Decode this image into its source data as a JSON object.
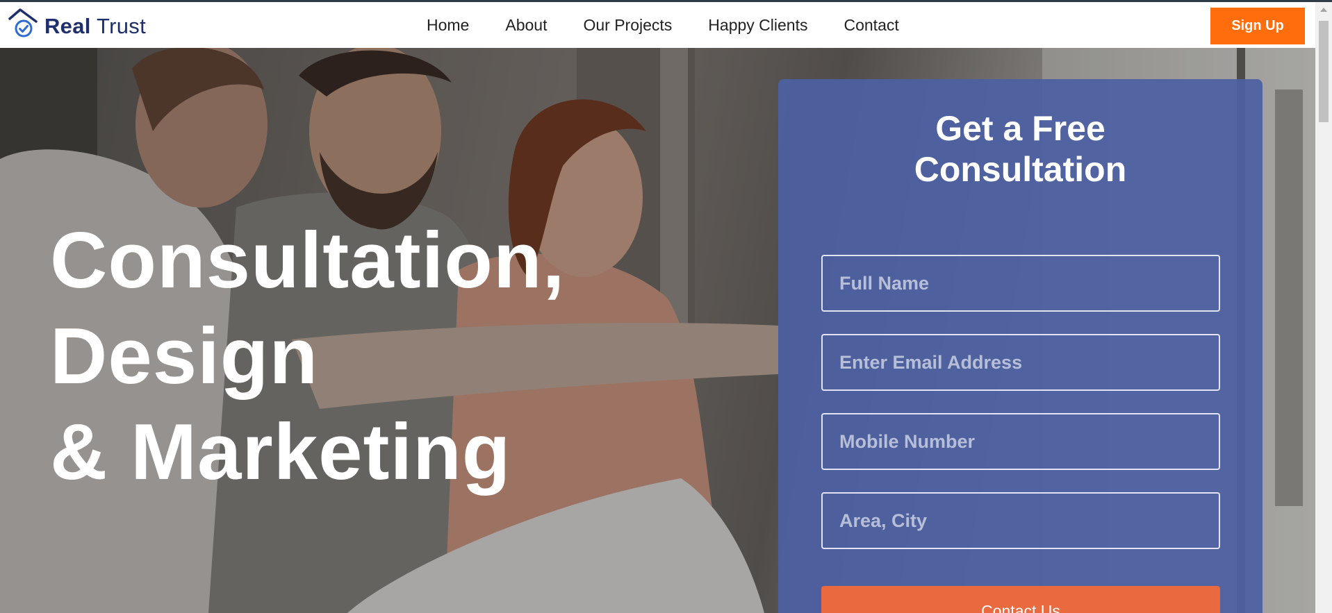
{
  "brand": {
    "name_bold": "Real",
    "name_rest": "Trust",
    "logo_icon": "house-check-icon",
    "color": "#1e2f6b"
  },
  "nav": {
    "items": [
      {
        "label": "Home"
      },
      {
        "label": "About"
      },
      {
        "label": "Our Projects"
      },
      {
        "label": "Happy Clients"
      },
      {
        "label": "Contact"
      }
    ],
    "signup_label": "Sign Up",
    "signup_color": "#ff6d0c"
  },
  "hero": {
    "heading_lines": [
      "Consultation,",
      "Design",
      "& Marketing"
    ]
  },
  "form": {
    "title_line1": "Get a Free",
    "title_line2": "Consultation",
    "fields": [
      {
        "placeholder": "Full Name",
        "value": ""
      },
      {
        "placeholder": "Enter Email Address",
        "value": ""
      },
      {
        "placeholder": "Mobile Number",
        "value": ""
      },
      {
        "placeholder": "Area, City",
        "value": ""
      }
    ],
    "submit_label": "Contact Us",
    "card_color": "#4c60a2",
    "submit_color": "#e86a3e"
  }
}
